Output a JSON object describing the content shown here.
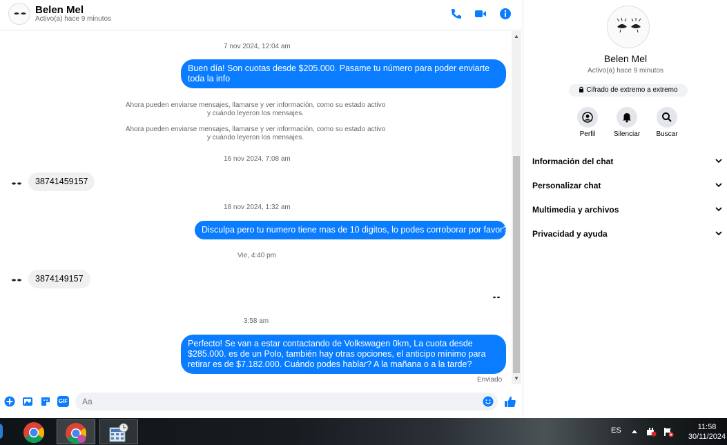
{
  "header": {
    "contact_name": "Belen Mel",
    "contact_status": "Activo(a) hace 9 minutos",
    "icons": [
      "phone-icon",
      "video-icon",
      "info-icon"
    ],
    "accent": "#0a7cff"
  },
  "chat": {
    "timestamps": [
      "7 nov 2024, 12:04 am",
      "16 nov 2024, 7:08 am",
      "18 nov 2024, 1:32 am",
      "Vie, 4:40 pm",
      "3:58 am"
    ],
    "system_messages": [
      "Ahora pueden enviarse mensajes, llamarse y ver información, como su estado activo y cuándo leyeron los mensajes.",
      "Ahora pueden enviarse mensajes, llamarse y ver información, como su estado activo y cuándo leyeron los mensajes."
    ],
    "messages": [
      {
        "dir": "out",
        "text": "Buen día! Son cuotas desde $205.000. Pasame tu número para poder enviarte toda la info"
      },
      {
        "dir": "in",
        "text": "38741459157"
      },
      {
        "dir": "out",
        "text": "Disculpa pero tu numero tiene mas de 10 digitos, lo podes corroborar por favor??"
      },
      {
        "dir": "in",
        "text": "3874149157"
      },
      {
        "dir": "out",
        "text": "Perfecto!  Se van a estar contactando de Volkswagen 0km, La cuota desde $285.000. es de un Polo, también hay otras opciones, el anticipo mínimo para retirar es de $7.182.000. Cuándo podes hablar? A la mañana o a la tarde?"
      }
    ],
    "sent_status": "Enviado"
  },
  "composer": {
    "placeholder": "Aa",
    "icons": [
      "plus-icon",
      "image-icon",
      "sticker-icon",
      "gif-icon",
      "emoji-icon",
      "like-icon"
    ],
    "gif_label": "GIF"
  },
  "panel": {
    "name": "Belen Mel",
    "status": "Activo(a) hace 9 minutos",
    "encryption": "Cifrado de extremo a extremo",
    "actions": [
      {
        "label": "Perfil",
        "icon": "profile-icon"
      },
      {
        "label": "Silenciar",
        "icon": "bell-icon"
      },
      {
        "label": "Buscar",
        "icon": "search-icon"
      }
    ],
    "sections": [
      "Información del chat",
      "Personalizar chat",
      "Multimedia y archivos",
      "Privacidad y ayuda"
    ]
  },
  "taskbar": {
    "lang": "ES",
    "time": "11:58",
    "date": "30/11/2024",
    "apps": [
      "chrome-icon",
      "chrome-profile-icon",
      "calculator-icon"
    ]
  }
}
